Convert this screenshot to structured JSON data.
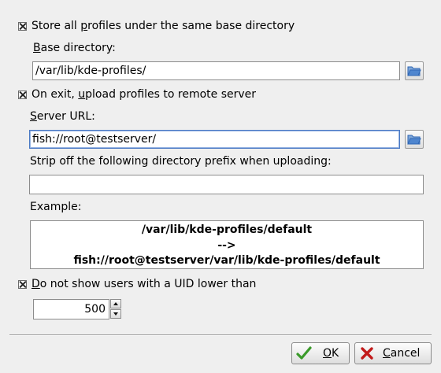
{
  "store_profiles": {
    "label_pre": "Store all ",
    "label_key": "p",
    "label_post": "rofiles under the same base directory",
    "checked": true
  },
  "base_dir": {
    "label_key": "B",
    "label_post": "ase directory:",
    "value": "/var/lib/kde-profiles/"
  },
  "upload": {
    "label_pre": "On exit, ",
    "label_key": "u",
    "label_post": "pload profiles to remote server",
    "checked": true
  },
  "server_url": {
    "label_key": "S",
    "label_post": "erver URL:",
    "value": "fish://root@testserver/"
  },
  "strip": {
    "label": "Strip off the following directory prefix when uploading:",
    "value": ""
  },
  "example": {
    "label": "Example:",
    "line1": "/var/lib/kde-profiles/default",
    "line2": "-->",
    "line3": "fish://root@testserver/var/lib/kde-profiles/default"
  },
  "uid": {
    "label_key": "D",
    "label_post": "o not show users with a UID lower than",
    "checked": true,
    "value": "500"
  },
  "buttons": {
    "ok_key": "O",
    "ok_post": "K",
    "cancel_key": "C",
    "cancel_post": "ancel"
  },
  "colors": {
    "ok_check": "#3a9a2a",
    "cancel_x": "#c21a1a",
    "folder": "#2f67b5"
  }
}
